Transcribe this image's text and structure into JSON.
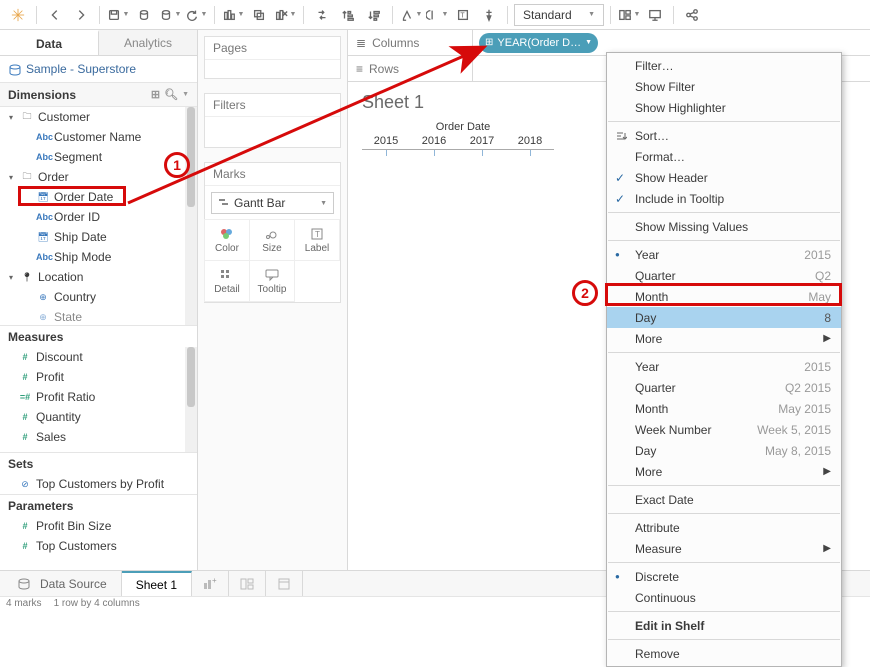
{
  "toolbar": {
    "fit_label": "Standard"
  },
  "left_pane": {
    "tab_data": "Data",
    "tab_analytics": "Analytics",
    "datasource": "Sample - Superstore",
    "dimensions_label": "Dimensions",
    "measures_label": "Measures",
    "sets_label": "Sets",
    "parameters_label": "Parameters",
    "dims": {
      "customer": "Customer",
      "customer_name": "Customer Name",
      "segment": "Segment",
      "order": "Order",
      "order_date": "Order Date",
      "order_id": "Order ID",
      "ship_date": "Ship Date",
      "ship_mode": "Ship Mode",
      "location": "Location",
      "country": "Country",
      "state": "State"
    },
    "meas": {
      "discount": "Discount",
      "profit": "Profit",
      "profit_ratio": "Profit Ratio",
      "quantity": "Quantity",
      "sales": "Sales"
    },
    "sets": {
      "top_customers": "Top Customers by Profit"
    },
    "params": {
      "profit_bin": "Profit Bin Size",
      "top_customers": "Top Customers"
    }
  },
  "cards": {
    "pages": "Pages",
    "filters": "Filters",
    "marks": "Marks",
    "mark_type": "Gantt Bar",
    "color": "Color",
    "size": "Size",
    "label": "Label",
    "detail": "Detail",
    "tooltip": "Tooltip"
  },
  "shelves": {
    "columns": "Columns",
    "rows": "Rows",
    "pill_year": "YEAR(Order D…"
  },
  "sheet": {
    "title": "Sheet 1",
    "field_header": "Order Date",
    "years": [
      "2015",
      "2016",
      "2017",
      "2018"
    ]
  },
  "menu": {
    "filter": "Filter…",
    "show_filter": "Show Filter",
    "show_highlighter": "Show Highlighter",
    "sort": "Sort…",
    "format": "Format…",
    "show_header": "Show Header",
    "include_tooltip": "Include in Tooltip",
    "show_missing": "Show Missing Values",
    "year": "Year",
    "year_ex": "2015",
    "quarter": "Quarter",
    "quarter_ex": "Q2",
    "month": "Month",
    "month_ex": "May",
    "day": "Day",
    "day_ex": "8",
    "more": "More",
    "year2_ex": "2015",
    "quarter2_ex": "Q2 2015",
    "month2_ex": "May 2015",
    "week_number": "Week Number",
    "week_ex": "Week 5, 2015",
    "day2_ex": "May 8, 2015",
    "exact_date": "Exact Date",
    "attribute": "Attribute",
    "measure": "Measure",
    "discrete": "Discrete",
    "continuous": "Continuous",
    "edit_in_shelf": "Edit in Shelf",
    "remove": "Remove"
  },
  "bottom": {
    "data_source": "Data Source",
    "sheet1": "Sheet 1"
  },
  "status": {
    "marks": "4 marks",
    "dims": "1 row by 4 columns"
  },
  "anno": {
    "one": "1",
    "two": "2"
  }
}
